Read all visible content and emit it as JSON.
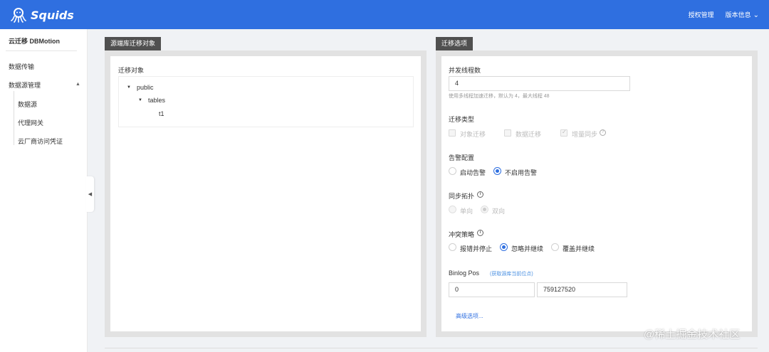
{
  "header": {
    "brand": "Squids",
    "logo_icon": "octopus-logo-icon",
    "links": [
      "授权管理",
      "版本信息"
    ],
    "accent_color": "#2f6fe0"
  },
  "sidebar": {
    "title": "云迁移 DBMotion",
    "items": [
      {
        "label": "数据传输"
      },
      {
        "label": "数据源管理",
        "expanded": true
      }
    ],
    "sub_items": [
      "数据源",
      "代理网关",
      "云厂商访问凭证"
    ]
  },
  "left_panel": {
    "tab": "源端库迁移对象",
    "section_label": "迁移对象",
    "tree": {
      "root": "public",
      "child": "tables",
      "leaf": "t1"
    }
  },
  "right_panel": {
    "tab": "迁移选项",
    "threads": {
      "label": "并发线程数",
      "value": "4",
      "hint": "使用多线程加速迁移，默认为 4，最大线程 48"
    },
    "migration_type": {
      "label": "迁移类型",
      "options": [
        {
          "label": "对象迁移",
          "checked": false,
          "disabled": true
        },
        {
          "label": "数据迁移",
          "checked": false,
          "disabled": true
        },
        {
          "label": "增量同步",
          "checked": true,
          "disabled": true
        }
      ]
    },
    "alarm": {
      "label": "告警配置",
      "options": [
        {
          "label": "启动告警",
          "selected": false
        },
        {
          "label": "不启用告警",
          "selected": true
        }
      ]
    },
    "topology": {
      "label": "同步拓扑",
      "options": [
        {
          "label": "单向",
          "selected": false,
          "disabled": true
        },
        {
          "label": "双向",
          "selected": true,
          "disabled": true
        }
      ]
    },
    "conflict": {
      "label": "冲突策略",
      "options": [
        {
          "label": "报错并停止",
          "selected": false
        },
        {
          "label": "忽略并继续",
          "selected": true
        },
        {
          "label": "覆盖并继续",
          "selected": false
        }
      ]
    },
    "binlog": {
      "label": "Binlog Pos",
      "fetch_link": "(获取源库当前位点)",
      "file_value": "0",
      "pos_value": "759127520"
    },
    "advanced_link": "高级选项..."
  },
  "watermark": "@稀土掘金技术社区"
}
